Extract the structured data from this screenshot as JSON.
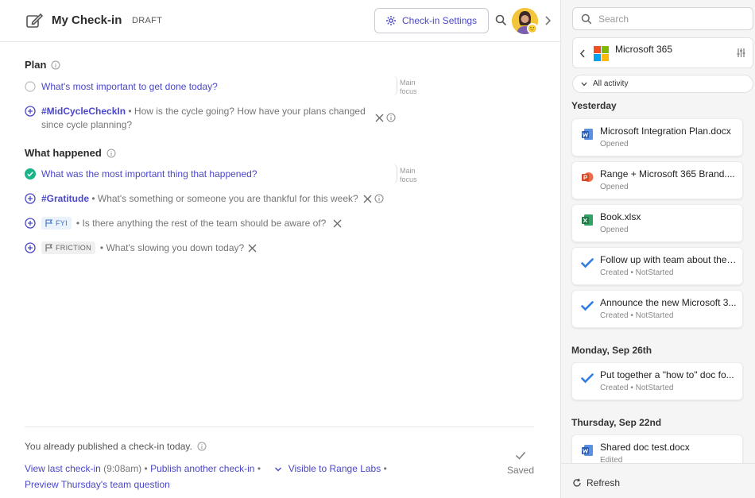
{
  "header": {
    "title": "My Check-in",
    "status": "DRAFT",
    "settings_label": "Check-in Settings"
  },
  "plan": {
    "title": "Plan",
    "q1": "What's most important to get done today?",
    "q1_focus": [
      "Main",
      "focus"
    ],
    "q2_tag": "#MidCycleCheckIn",
    "q2_text": " • How is the cycle going? How have your plans changed since cycle planning?"
  },
  "happened": {
    "title": "What happened",
    "q1": "What was the most important thing that happened?",
    "q1_focus": [
      "Main",
      "focus"
    ],
    "q2_tag": "#Gratitude",
    "q2_text": " • What's something or someone you are thankful for this week?",
    "q3_chip": "FYI",
    "q3_text": "• Is there anything the rest of the team should be aware of?",
    "q4_chip": "FRICTION",
    "q4_text": "• What's slowing you down today?"
  },
  "footer": {
    "published": "You already published a check-in today.",
    "view_last": "View last check-in",
    "view_time": " (9:08am) • ",
    "publish_another": "Publish another check-in",
    "sep": " • ",
    "visible": "Visible to Range Labs",
    "sep2": " •",
    "preview": "Preview Thursday's team question",
    "saved": "Saved"
  },
  "sidebar": {
    "search_placeholder": "Search",
    "app_name": "Microsoft 365",
    "filter": "All activity",
    "groups": [
      {
        "day": "Yesterday",
        "items": [
          {
            "icon": "word-icon",
            "title": "Microsoft Integration Plan.docx",
            "sub": "Opened"
          },
          {
            "icon": "powerpoint-icon",
            "title": "Range + Microsoft 365 Brand....",
            "sub": "Opened"
          },
          {
            "icon": "excel-icon",
            "title": "Book.xlsx",
            "sub": "Opened"
          },
          {
            "icon": "todo-icon",
            "title": "Follow up with team about the ...",
            "sub": "Created • NotStarted"
          },
          {
            "icon": "todo-icon",
            "title": "Announce the new Microsoft 3...",
            "sub": "Created • NotStarted"
          }
        ]
      },
      {
        "day": "Monday, Sep 26th",
        "items": [
          {
            "icon": "todo-icon",
            "title": "Put together a \"how to\" doc fo...",
            "sub": "Created • NotStarted"
          }
        ]
      },
      {
        "day": "Thursday, Sep 22nd",
        "items": [
          {
            "icon": "word-icon",
            "title": "Shared doc test.docx",
            "sub": "Edited"
          }
        ]
      }
    ],
    "refresh": "Refresh"
  },
  "colors": {
    "accent": "#4a47c8",
    "done": "#1bb38a",
    "word": "#2b5fb4",
    "excel": "#1d7a45",
    "powerpoint": "#d24726",
    "todo": "#2f7de1"
  }
}
